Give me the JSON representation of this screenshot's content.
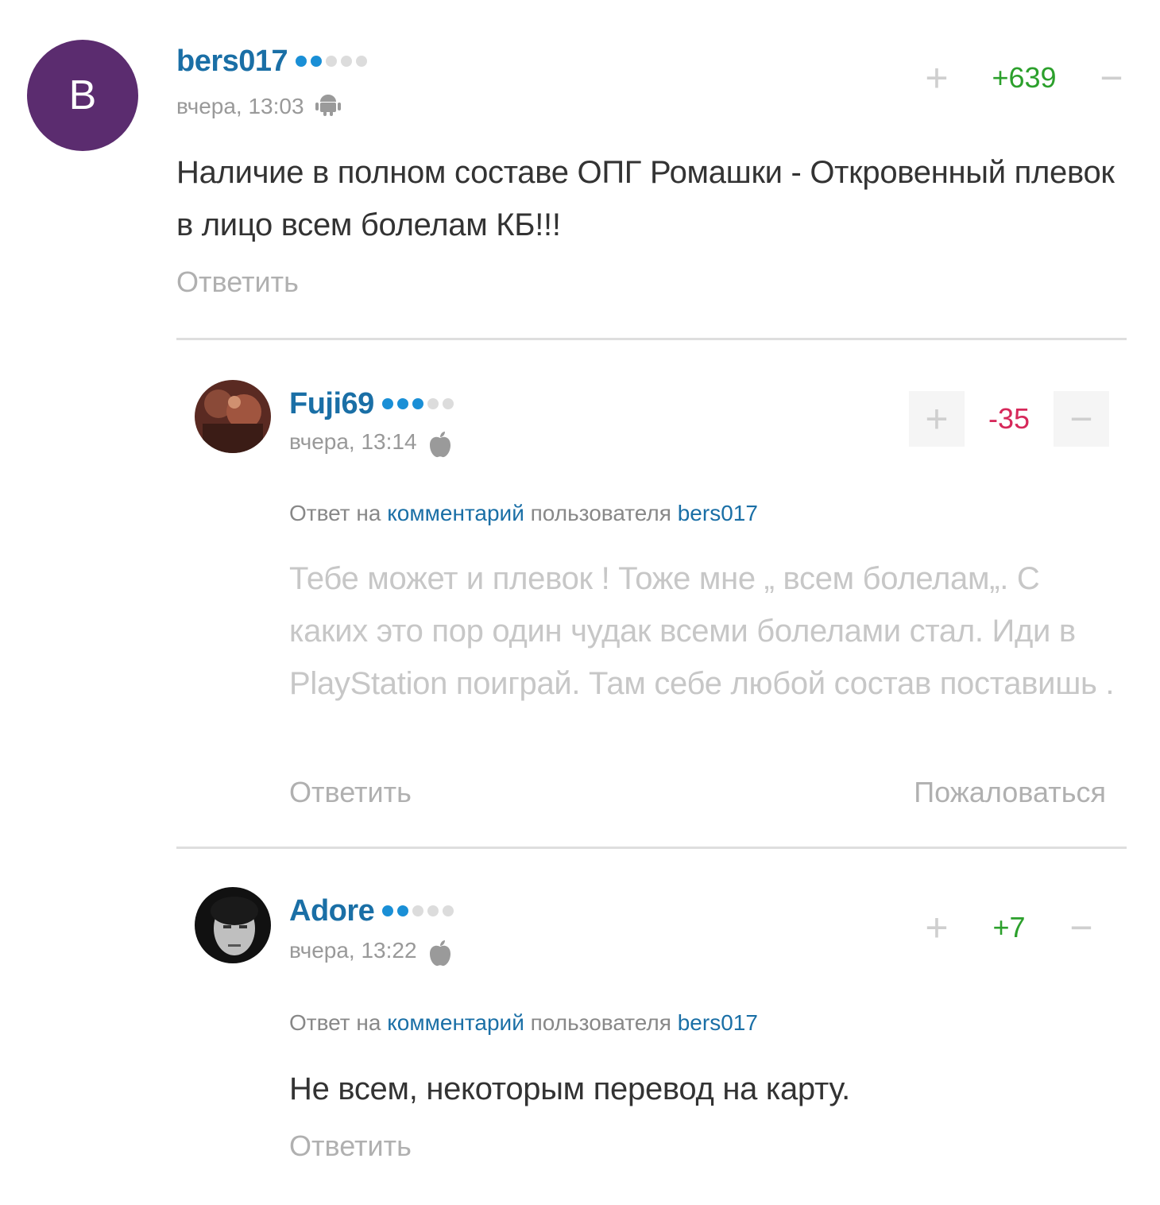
{
  "comments": [
    {
      "avatar_letter": "B",
      "avatar_color": "#5b2c6f",
      "username": "bers017",
      "level_dots": 2,
      "date": "вчера, 13:03",
      "device": "android-icon",
      "score": "+639",
      "text": "Наличие в полном составе ОПГ Ромашки - Откровенный плевок в лицо всем болелам КБ!!!",
      "reply_label": "Ответить"
    },
    {
      "username": "Fuji69",
      "level_dots": 3,
      "date": "вчера, 13:14",
      "device": "apple-icon",
      "score": "-35",
      "reply_prefix": "Ответ на",
      "reply_comment_link": "комментарий",
      "reply_user_prefix": "пользователя",
      "reply_user": "bers017",
      "text": "Тебе может и плевок ! Тоже мне „ всем болелам„. С каких это пор один чудак всеми болелами стал. Иди в PlayStation поиграй. Там себе любой состав поставишь .",
      "reply_label": "Ответить",
      "report_label": "Пожаловаться"
    },
    {
      "username": "Adore",
      "level_dots": 2,
      "date": "вчера, 13:22",
      "device": "apple-icon",
      "score": "+7",
      "reply_prefix": "Ответ на",
      "reply_comment_link": "комментарий",
      "reply_user_prefix": "пользователя",
      "reply_user": "bers017",
      "text": "Не всем, некоторым перевод на карту.",
      "reply_label": "Ответить"
    }
  ],
  "vote": {
    "plus": "+",
    "minus": "−"
  }
}
